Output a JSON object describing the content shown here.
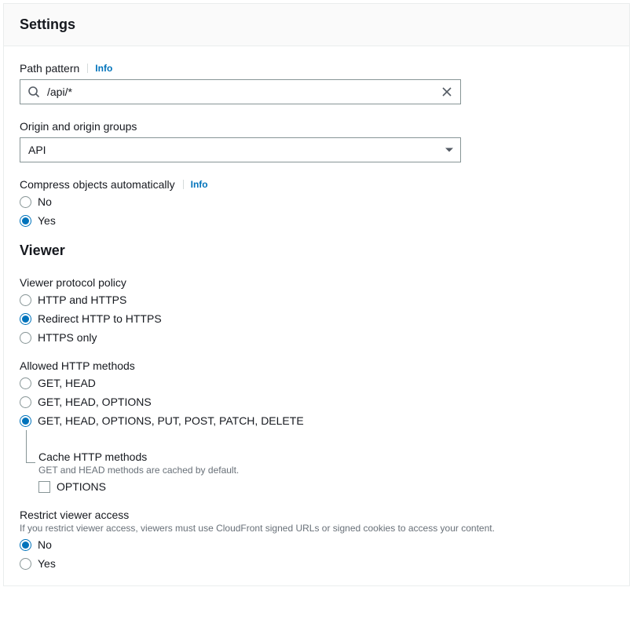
{
  "panel_title": "Settings",
  "path_pattern": {
    "label": "Path pattern",
    "info": "Info",
    "value": "/api/*"
  },
  "origin": {
    "label": "Origin and origin groups",
    "selected": "API"
  },
  "compress": {
    "label": "Compress objects automatically",
    "info": "Info",
    "no": "No",
    "yes": "Yes",
    "selected": "yes"
  },
  "viewer": {
    "heading": "Viewer",
    "protocol": {
      "label": "Viewer protocol policy",
      "options": {
        "http_and_https": "HTTP and HTTPS",
        "redirect": "Redirect HTTP to HTTPS",
        "https_only": "HTTPS only"
      },
      "selected": "redirect"
    },
    "methods": {
      "label": "Allowed HTTP methods",
      "options": {
        "get_head": "GET, HEAD",
        "get_head_options": "GET, HEAD, OPTIONS",
        "all": "GET, HEAD, OPTIONS, PUT, POST, PATCH, DELETE"
      },
      "selected": "all",
      "cache": {
        "title": "Cache HTTP methods",
        "desc": "GET and HEAD methods are cached by default.",
        "options_checkbox": "OPTIONS",
        "options_checked": false
      }
    },
    "restrict": {
      "label": "Restrict viewer access",
      "desc": "If you restrict viewer access, viewers must use CloudFront signed URLs or signed cookies to access your content.",
      "no": "No",
      "yes": "Yes",
      "selected": "no"
    }
  }
}
